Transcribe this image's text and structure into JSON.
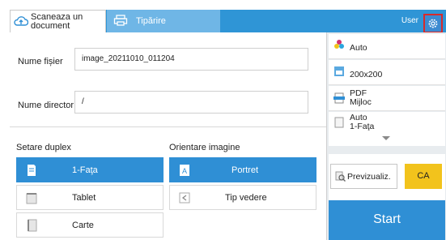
{
  "header": {
    "tab_scan_label_1": "Scaneaza un",
    "tab_scan_label_2": "document",
    "tab_print_label": "Tipărire",
    "user_label": "User"
  },
  "form": {
    "filename_label": "Nume fișier",
    "filename_value": "image_20211010_011204",
    "directory_label": "Nume director",
    "directory_value": "/"
  },
  "duplex": {
    "label": "Setare duplex",
    "options": [
      "1-Faţa",
      "Tablet",
      "Carte"
    ],
    "selected": "1-Faţa"
  },
  "orientation": {
    "label": "Orientare imagine",
    "options": [
      "Portret",
      "Tip vedere"
    ],
    "selected": "Portret"
  },
  "settings_panel": {
    "color": "Auto",
    "resolution": "200x200",
    "format_line1": "PDF",
    "format_line2": "Mijloc",
    "size_line1": "Auto",
    "size_line2": "1-Faţa"
  },
  "actions": {
    "preview_label": "Previzualiz.",
    "ca_label": "CA",
    "start_label": "Start"
  },
  "colors": {
    "accent": "#2f8fd5",
    "topbar": "#2f95d6",
    "ca_button": "#f2c31c",
    "highlight_border": "#d82a2a"
  }
}
